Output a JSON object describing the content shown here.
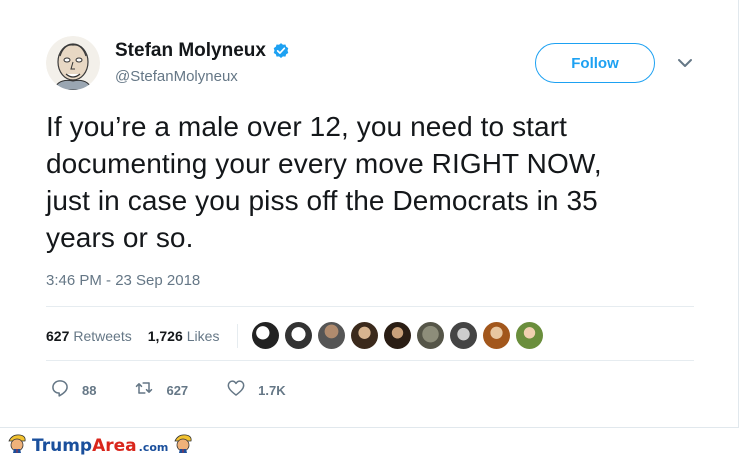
{
  "tweet": {
    "author_name": "Stefan Molyneux",
    "author_handle": "@StefanMolyneux",
    "follow_label": "Follow",
    "text": "If you’re a male over 12, you need to start\ndocumenting your every move RIGHT NOW,\njust in case you piss off the Democrats in 35\nyears or so.",
    "timestamp": "3:46 PM - 23 Sep 2018",
    "retweets_count": "627",
    "retweets_label": "Retweets",
    "likes_count": "1,726",
    "likes_label": "Likes",
    "reply_count": "88",
    "retweet_action_count": "627",
    "like_action_count": "1.7K"
  },
  "icons": {
    "verified": "verified-badge-icon",
    "caret": "chevron-down-icon",
    "reply": "reply-icon",
    "retweet": "retweet-icon",
    "like": "heart-icon"
  },
  "colors": {
    "accent": "#1da1f2",
    "text_primary": "#14171a",
    "text_secondary": "#657786",
    "divider": "#e6ecf0"
  },
  "watermark": {
    "brand_part1": "Trump",
    "brand_part2": "Area",
    "brand_suffix": ".com"
  }
}
